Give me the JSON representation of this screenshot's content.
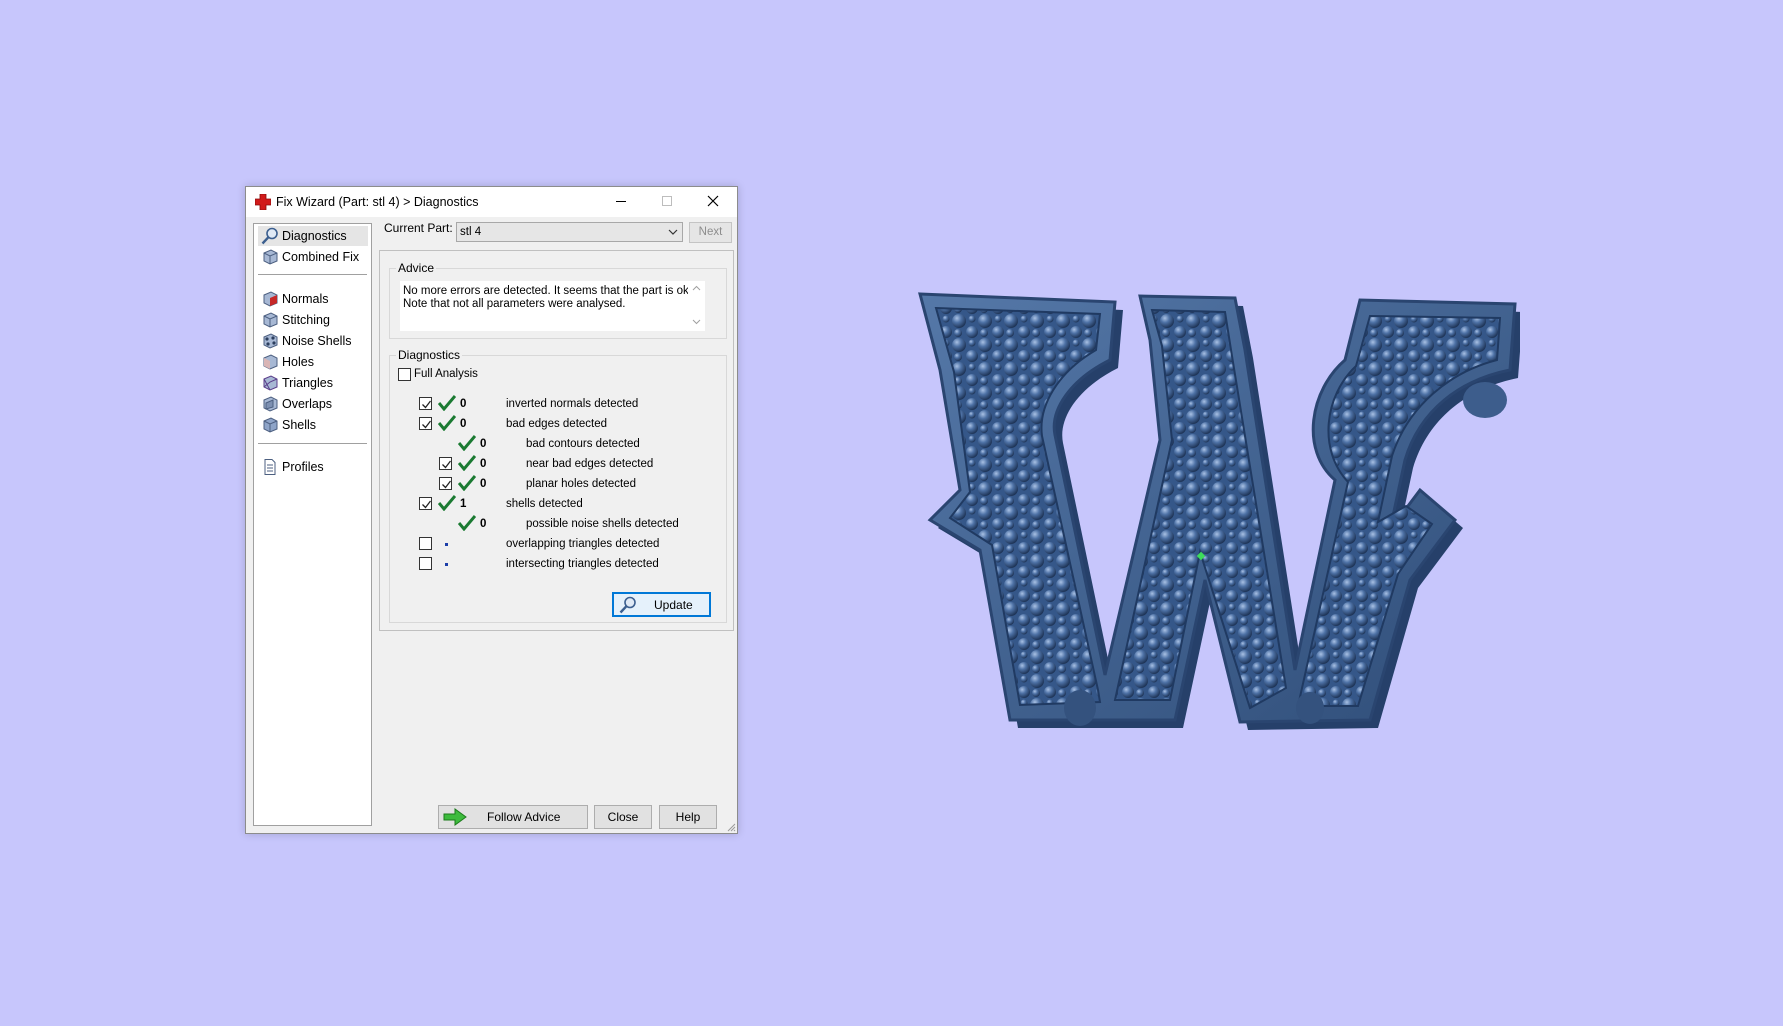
{
  "window": {
    "title": "Fix Wizard (Part: stl 4) > Diagnostics"
  },
  "nav": {
    "items": [
      {
        "label": "Diagnostics",
        "icon": "magnifier-icon"
      },
      {
        "label": "Combined Fix",
        "icon": "cube-icon"
      },
      {
        "label": "Normals",
        "icon": "normals-cube-icon"
      },
      {
        "label": "Stitching",
        "icon": "stitching-cube-icon"
      },
      {
        "label": "Noise Shells",
        "icon": "noise-shells-icon"
      },
      {
        "label": "Holes",
        "icon": "holes-cube-icon"
      },
      {
        "label": "Triangles",
        "icon": "triangles-cube-icon"
      },
      {
        "label": "Overlaps",
        "icon": "overlaps-cube-icon"
      },
      {
        "label": "Shells",
        "icon": "shells-cube-icon"
      },
      {
        "label": "Profiles",
        "icon": "document-icon"
      }
    ]
  },
  "header": {
    "current_part_label": "Current Part:",
    "current_part_value": "stl 4",
    "next_label": "Next"
  },
  "advice": {
    "title": "Advice",
    "text": "No more errors are detected. It seems that the part is ok.\nNote that not all parameters were analysed."
  },
  "diagnostics": {
    "title": "Diagnostics",
    "full_analysis_label": "Full Analysis",
    "full_analysis_checked": false,
    "rows": [
      {
        "checkbox": true,
        "checked": true,
        "status": "ok",
        "count": "0",
        "label": "inverted normals detected",
        "indent": 0
      },
      {
        "checkbox": true,
        "checked": true,
        "status": "ok",
        "count": "0",
        "label": "bad edges detected",
        "indent": 0
      },
      {
        "checkbox": false,
        "checked": false,
        "status": "ok",
        "count": "0",
        "label": "bad contours detected",
        "indent": 1
      },
      {
        "checkbox": true,
        "checked": true,
        "status": "ok",
        "count": "0",
        "label": "near bad edges detected",
        "indent": 1
      },
      {
        "checkbox": true,
        "checked": true,
        "status": "ok",
        "count": "0",
        "label": "planar holes detected",
        "indent": 1
      },
      {
        "checkbox": true,
        "checked": true,
        "status": "ok",
        "count": "1",
        "label": "shells detected",
        "indent": 0
      },
      {
        "checkbox": false,
        "checked": false,
        "status": "ok",
        "count": "0",
        "label": "possible noise shells detected",
        "indent": 1
      },
      {
        "checkbox": true,
        "checked": false,
        "status": "not-analysed",
        "count": "",
        "label": "overlapping triangles detected",
        "indent": 0
      },
      {
        "checkbox": true,
        "checked": false,
        "status": "not-analysed",
        "count": "",
        "label": "intersecting triangles detected",
        "indent": 0
      }
    ],
    "update_label": "Update"
  },
  "footer": {
    "follow_advice_label": "Follow Advice",
    "close_label": "Close",
    "help_label": "Help"
  },
  "colors": {
    "desktop_background": "#c7c6fc",
    "model_blue": "#3f6190",
    "accent": "#0078d7",
    "ok_tick": "#1b7a32"
  }
}
